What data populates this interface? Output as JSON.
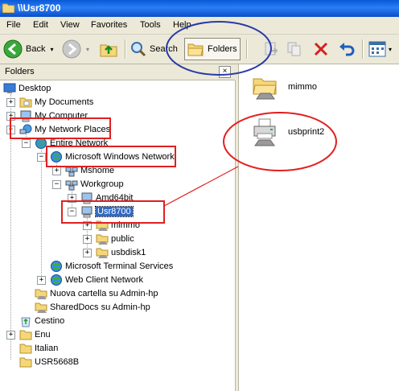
{
  "window": {
    "title": "\\\\Usr8700"
  },
  "menu": [
    "File",
    "Edit",
    "View",
    "Favorites",
    "Tools",
    "Help"
  ],
  "toolbar": {
    "back_label": "Back",
    "search_label": "Search",
    "folders_label": "Folders"
  },
  "folders_pane": {
    "title": "Folders"
  },
  "tree": {
    "desktop": "Desktop",
    "my_documents": "My Documents",
    "my_computer": "My Computer",
    "my_network_places": "My Network Places",
    "entire_network": "Entire Network",
    "ms_windows_network": "Microsoft Windows Network",
    "mshome": "Mshome",
    "workgroup": "Workgroup",
    "amd64bit": "Amd64bit",
    "usr8700": "Usr8700",
    "mimmo": "mimmo",
    "public": "public",
    "usbdisk1": "usbdisk1",
    "ms_terminal_services": "Microsoft Terminal Services",
    "web_client_network": "Web Client Network",
    "nuova_cartella": "Nuova cartella su Admin-hp",
    "shareddocs": "SharedDocs su Admin-hp",
    "cestino": "Cestino",
    "enu": "Enu",
    "italian": "Italian",
    "usr5668b": "USR5668B"
  },
  "content": {
    "items": [
      "mimmo",
      "usbprint2"
    ]
  },
  "colors": {
    "annotation_red": "#e02020",
    "annotation_blue": "#2a3aa8",
    "selection": "#316ac5"
  }
}
